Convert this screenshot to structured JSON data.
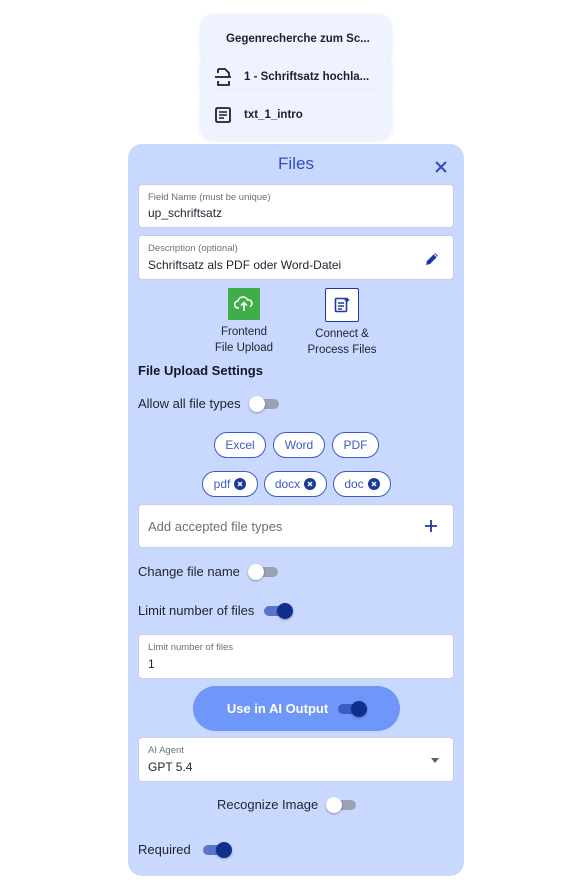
{
  "nodes": [
    {
      "label": "Gegenrecherche zum Sc...",
      "icon": "none"
    },
    {
      "label": "1 - Schriftsatz hochla...",
      "icon": "upload-doc-icon"
    },
    {
      "label": "txt_1_intro",
      "icon": "text-doc-icon"
    }
  ],
  "panel": {
    "title": "Files",
    "field_name": {
      "label": "Field Name (must be unique)",
      "value": "up_schriftsatz"
    },
    "description": {
      "label": "Description (optional)",
      "value": "Schriftsatz als PDF oder Word-Datei"
    },
    "modes": [
      {
        "line1": "Frontend",
        "line2": "File Upload",
        "icon": "cloud-upload-icon",
        "active": true
      },
      {
        "line1": "Connect &",
        "line2": "Process Files",
        "icon": "process-file-icon",
        "active": false
      }
    ],
    "upload_settings_title": "File Upload Settings",
    "allow_all": {
      "label": "Allow all file types",
      "on": false
    },
    "preset_chips": [
      "Excel",
      "Word",
      "PDF"
    ],
    "accepted_types": [
      "pdf",
      "docx",
      "doc"
    ],
    "add_types_placeholder": "Add accepted file types",
    "change_file_name": {
      "label": "Change file name",
      "on": false
    },
    "limit_files": {
      "label": "Limit number of files",
      "on": true
    },
    "limit_field": {
      "label": "Limit number of files",
      "value": "1"
    },
    "ai_output": {
      "label": "Use in AI Output",
      "on": true
    },
    "ai_agent": {
      "label": "AI Agent",
      "value": "GPT 5.4"
    },
    "recognize_image": {
      "label": "Recognize Image",
      "on": false
    },
    "required": {
      "label": "Required",
      "on": true
    }
  },
  "colors": {
    "panel_bg": "#c9d8ff",
    "accent": "#2f4fb7",
    "toggle_on": "#0e2f8c",
    "ai_button": "#6f96f9",
    "upload_active": "#3fae49"
  }
}
